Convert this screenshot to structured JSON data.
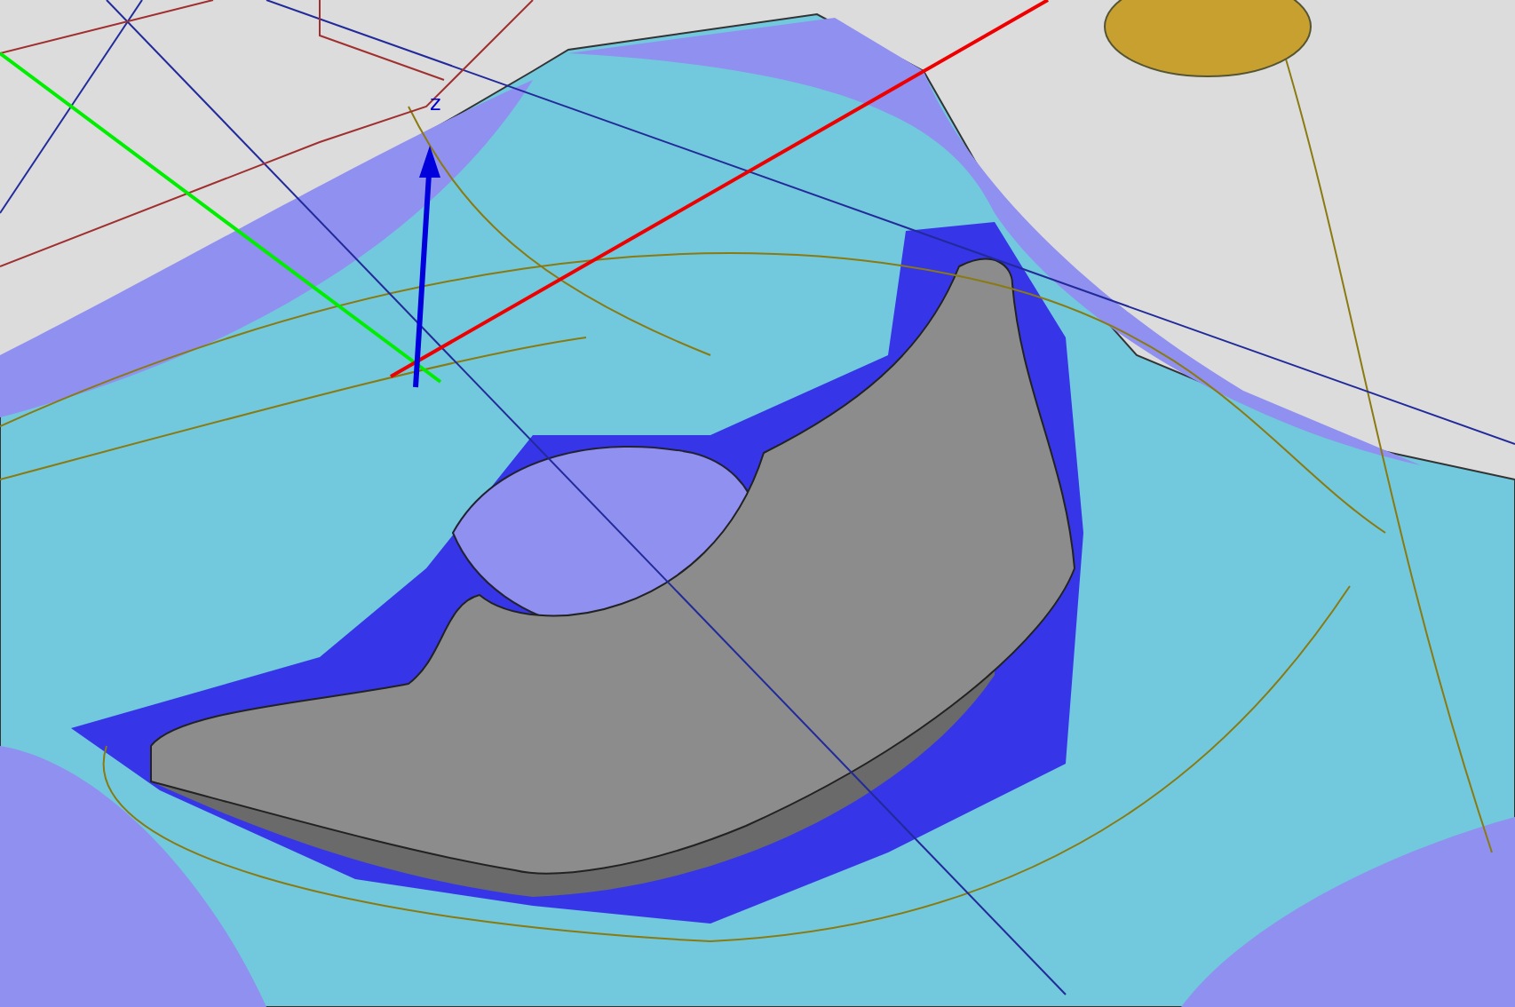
{
  "viewport": {
    "axis_label": "z"
  }
}
